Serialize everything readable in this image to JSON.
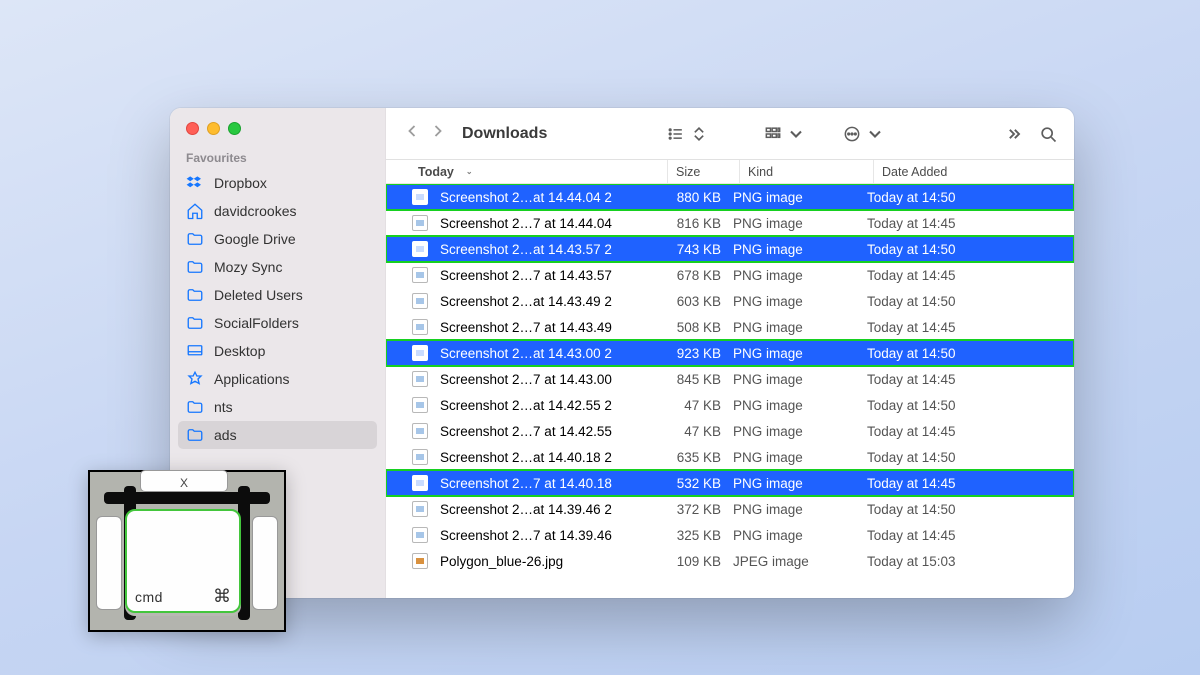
{
  "window": {
    "title": "Downloads"
  },
  "sidebar": {
    "heading": "Favourites",
    "items": [
      {
        "label": "Dropbox"
      },
      {
        "label": "davidcrookes"
      },
      {
        "label": "Google Drive"
      },
      {
        "label": "Mozy Sync"
      },
      {
        "label": "Deleted Users"
      },
      {
        "label": "SocialFolders"
      },
      {
        "label": "Desktop"
      },
      {
        "label": "Applications"
      },
      {
        "label": "nts"
      },
      {
        "label": "ads"
      }
    ]
  },
  "columns": {
    "name": "Today",
    "size": "Size",
    "kind": "Kind",
    "date": "Date Added"
  },
  "files": [
    {
      "name": "Screenshot 2…at 14.44.04 2",
      "size": "880 KB",
      "kind": "PNG image",
      "date": "Today at 14:50",
      "sel": true,
      "hl": true
    },
    {
      "name": "Screenshot 2…7 at 14.44.04",
      "size": "816 KB",
      "kind": "PNG image",
      "date": "Today at 14:45",
      "sel": false,
      "hl": false
    },
    {
      "name": "Screenshot 2…at 14.43.57 2",
      "size": "743 KB",
      "kind": "PNG image",
      "date": "Today at 14:50",
      "sel": true,
      "hl": true
    },
    {
      "name": "Screenshot 2…7 at 14.43.57",
      "size": "678 KB",
      "kind": "PNG image",
      "date": "Today at 14:45",
      "sel": false,
      "hl": false
    },
    {
      "name": "Screenshot 2…at 14.43.49 2",
      "size": "603 KB",
      "kind": "PNG image",
      "date": "Today at 14:50",
      "sel": false,
      "hl": false
    },
    {
      "name": "Screenshot 2…7 at 14.43.49",
      "size": "508 KB",
      "kind": "PNG image",
      "date": "Today at 14:45",
      "sel": false,
      "hl": false
    },
    {
      "name": "Screenshot 2…at 14.43.00 2",
      "size": "923 KB",
      "kind": "PNG image",
      "date": "Today at 14:50",
      "sel": true,
      "hl": true
    },
    {
      "name": "Screenshot 2…7 at 14.43.00",
      "size": "845 KB",
      "kind": "PNG image",
      "date": "Today at 14:45",
      "sel": false,
      "hl": false
    },
    {
      "name": "Screenshot 2…at 14.42.55 2",
      "size": "47 KB",
      "kind": "PNG image",
      "date": "Today at 14:50",
      "sel": false,
      "hl": false
    },
    {
      "name": "Screenshot 2…7 at 14.42.55",
      "size": "47 KB",
      "kind": "PNG image",
      "date": "Today at 14:45",
      "sel": false,
      "hl": false
    },
    {
      "name": "Screenshot 2…at 14.40.18 2",
      "size": "635 KB",
      "kind": "PNG image",
      "date": "Today at 14:50",
      "sel": false,
      "hl": false
    },
    {
      "name": "Screenshot 2…7 at 14.40.18",
      "size": "532 KB",
      "kind": "PNG image",
      "date": "Today at 14:45",
      "sel": true,
      "hl": true
    },
    {
      "name": "Screenshot 2…at 14.39.46 2",
      "size": "372 KB",
      "kind": "PNG image",
      "date": "Today at 14:50",
      "sel": false,
      "hl": false
    },
    {
      "name": "Screenshot 2…7 at 14.39.46",
      "size": "325 KB",
      "kind": "PNG image",
      "date": "Today at 14:45",
      "sel": false,
      "hl": false
    },
    {
      "name": "Polygon_blue-26.jpg",
      "size": "109 KB",
      "kind": "JPEG image",
      "date": "Today at 15:03",
      "sel": false,
      "hl": false,
      "jpeg": true
    }
  ],
  "keycap": {
    "label": "cmd",
    "symbol": "⌘",
    "above": "X"
  }
}
